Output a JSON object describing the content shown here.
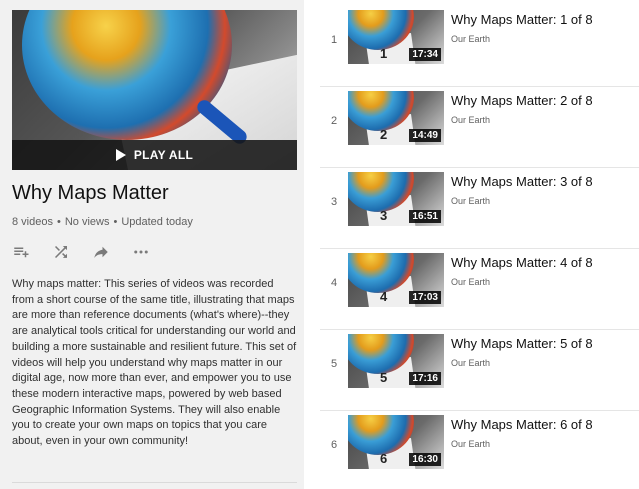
{
  "playlist": {
    "play_all_label": "PLAY ALL",
    "title": "Why Maps Matter",
    "video_count": "8 videos",
    "views": "No views",
    "updated": "Updated today",
    "separator": "•",
    "description": "Why maps matter:  This series of videos was recorded from a short course of the same title, illustrating that maps are more than reference documents (what's where)--they are analytical tools critical for understanding our world and building a more sustainable and resilient future.  This set of videos will help you understand why maps matter in our digital age, now more than ever, and empower you to use these modern interactive maps, powered by web based Geographic Information Systems.  They will also enable you to create your own maps on topics that you care about, even in your own community!"
  },
  "actions": [
    {
      "icon": "add-to-queue-icon"
    },
    {
      "icon": "shuffle-icon"
    },
    {
      "icon": "share-icon"
    },
    {
      "icon": "more-icon"
    }
  ],
  "videos": [
    {
      "index": "1",
      "title": "Why Maps Matter: 1 of 8",
      "channel": "Our Earth",
      "duration": "17:34",
      "thumb_num": "1"
    },
    {
      "index": "2",
      "title": "Why Maps Matter: 2 of 8",
      "channel": "Our Earth",
      "duration": "14:49",
      "thumb_num": "2"
    },
    {
      "index": "3",
      "title": "Why Maps Matter: 3 of 8",
      "channel": "Our Earth",
      "duration": "16:51",
      "thumb_num": "3"
    },
    {
      "index": "4",
      "title": "Why Maps Matter: 4 of 8",
      "channel": "Our Earth",
      "duration": "17:03",
      "thumb_num": "4"
    },
    {
      "index": "5",
      "title": "Why Maps Matter: 5 of 8",
      "channel": "Our Earth",
      "duration": "17:16",
      "thumb_num": "5"
    },
    {
      "index": "6",
      "title": "Why Maps Matter: 6 of 8",
      "channel": "Our Earth",
      "duration": "16:30",
      "thumb_num": "6"
    }
  ]
}
